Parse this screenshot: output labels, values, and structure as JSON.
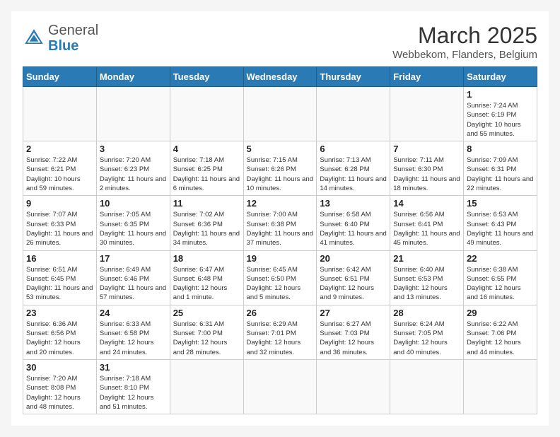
{
  "header": {
    "logo_general": "General",
    "logo_blue": "Blue",
    "title": "March 2025",
    "location": "Webbekom, Flanders, Belgium"
  },
  "days_of_week": [
    "Sunday",
    "Monday",
    "Tuesday",
    "Wednesday",
    "Thursday",
    "Friday",
    "Saturday"
  ],
  "weeks": [
    [
      {
        "day": "",
        "info": ""
      },
      {
        "day": "",
        "info": ""
      },
      {
        "day": "",
        "info": ""
      },
      {
        "day": "",
        "info": ""
      },
      {
        "day": "",
        "info": ""
      },
      {
        "day": "",
        "info": ""
      },
      {
        "day": "1",
        "info": "Sunrise: 7:24 AM\nSunset: 6:19 PM\nDaylight: 10 hours and 55 minutes."
      }
    ],
    [
      {
        "day": "2",
        "info": "Sunrise: 7:22 AM\nSunset: 6:21 PM\nDaylight: 10 hours and 59 minutes."
      },
      {
        "day": "3",
        "info": "Sunrise: 7:20 AM\nSunset: 6:23 PM\nDaylight: 11 hours and 2 minutes."
      },
      {
        "day": "4",
        "info": "Sunrise: 7:18 AM\nSunset: 6:25 PM\nDaylight: 11 hours and 6 minutes."
      },
      {
        "day": "5",
        "info": "Sunrise: 7:15 AM\nSunset: 6:26 PM\nDaylight: 11 hours and 10 minutes."
      },
      {
        "day": "6",
        "info": "Sunrise: 7:13 AM\nSunset: 6:28 PM\nDaylight: 11 hours and 14 minutes."
      },
      {
        "day": "7",
        "info": "Sunrise: 7:11 AM\nSunset: 6:30 PM\nDaylight: 11 hours and 18 minutes."
      },
      {
        "day": "8",
        "info": "Sunrise: 7:09 AM\nSunset: 6:31 PM\nDaylight: 11 hours and 22 minutes."
      }
    ],
    [
      {
        "day": "9",
        "info": "Sunrise: 7:07 AM\nSunset: 6:33 PM\nDaylight: 11 hours and 26 minutes."
      },
      {
        "day": "10",
        "info": "Sunrise: 7:05 AM\nSunset: 6:35 PM\nDaylight: 11 hours and 30 minutes."
      },
      {
        "day": "11",
        "info": "Sunrise: 7:02 AM\nSunset: 6:36 PM\nDaylight: 11 hours and 34 minutes."
      },
      {
        "day": "12",
        "info": "Sunrise: 7:00 AM\nSunset: 6:38 PM\nDaylight: 11 hours and 37 minutes."
      },
      {
        "day": "13",
        "info": "Sunrise: 6:58 AM\nSunset: 6:40 PM\nDaylight: 11 hours and 41 minutes."
      },
      {
        "day": "14",
        "info": "Sunrise: 6:56 AM\nSunset: 6:41 PM\nDaylight: 11 hours and 45 minutes."
      },
      {
        "day": "15",
        "info": "Sunrise: 6:53 AM\nSunset: 6:43 PM\nDaylight: 11 hours and 49 minutes."
      }
    ],
    [
      {
        "day": "16",
        "info": "Sunrise: 6:51 AM\nSunset: 6:45 PM\nDaylight: 11 hours and 53 minutes."
      },
      {
        "day": "17",
        "info": "Sunrise: 6:49 AM\nSunset: 6:46 PM\nDaylight: 11 hours and 57 minutes."
      },
      {
        "day": "18",
        "info": "Sunrise: 6:47 AM\nSunset: 6:48 PM\nDaylight: 12 hours and 1 minute."
      },
      {
        "day": "19",
        "info": "Sunrise: 6:45 AM\nSunset: 6:50 PM\nDaylight: 12 hours and 5 minutes."
      },
      {
        "day": "20",
        "info": "Sunrise: 6:42 AM\nSunset: 6:51 PM\nDaylight: 12 hours and 9 minutes."
      },
      {
        "day": "21",
        "info": "Sunrise: 6:40 AM\nSunset: 6:53 PM\nDaylight: 12 hours and 13 minutes."
      },
      {
        "day": "22",
        "info": "Sunrise: 6:38 AM\nSunset: 6:55 PM\nDaylight: 12 hours and 16 minutes."
      }
    ],
    [
      {
        "day": "23",
        "info": "Sunrise: 6:36 AM\nSunset: 6:56 PM\nDaylight: 12 hours and 20 minutes."
      },
      {
        "day": "24",
        "info": "Sunrise: 6:33 AM\nSunset: 6:58 PM\nDaylight: 12 hours and 24 minutes."
      },
      {
        "day": "25",
        "info": "Sunrise: 6:31 AM\nSunset: 7:00 PM\nDaylight: 12 hours and 28 minutes."
      },
      {
        "day": "26",
        "info": "Sunrise: 6:29 AM\nSunset: 7:01 PM\nDaylight: 12 hours and 32 minutes."
      },
      {
        "day": "27",
        "info": "Sunrise: 6:27 AM\nSunset: 7:03 PM\nDaylight: 12 hours and 36 minutes."
      },
      {
        "day": "28",
        "info": "Sunrise: 6:24 AM\nSunset: 7:05 PM\nDaylight: 12 hours and 40 minutes."
      },
      {
        "day": "29",
        "info": "Sunrise: 6:22 AM\nSunset: 7:06 PM\nDaylight: 12 hours and 44 minutes."
      }
    ],
    [
      {
        "day": "30",
        "info": "Sunrise: 7:20 AM\nSunset: 8:08 PM\nDaylight: 12 hours and 48 minutes."
      },
      {
        "day": "31",
        "info": "Sunrise: 7:18 AM\nSunset: 8:10 PM\nDaylight: 12 hours and 51 minutes."
      },
      {
        "day": "",
        "info": ""
      },
      {
        "day": "",
        "info": ""
      },
      {
        "day": "",
        "info": ""
      },
      {
        "day": "",
        "info": ""
      },
      {
        "day": "",
        "info": ""
      }
    ]
  ]
}
